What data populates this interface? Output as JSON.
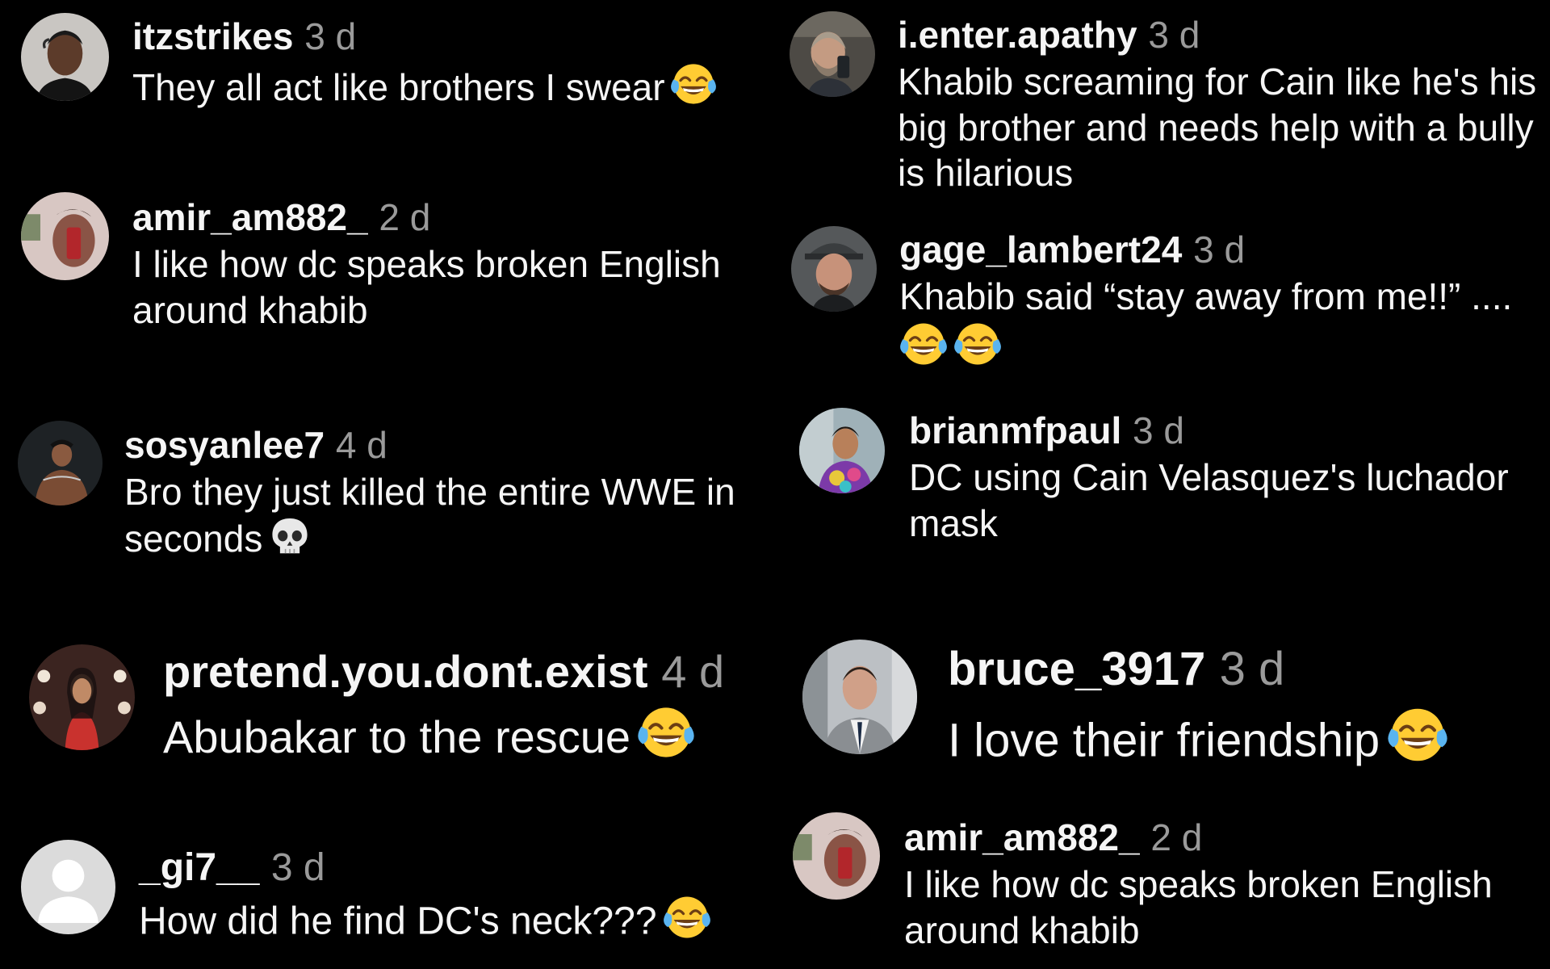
{
  "comments": [
    {
      "username": "itzstrikes",
      "time": "3 d",
      "text": "They all act like brothers I swear",
      "emoji": [
        "face-with-tears-of-joy"
      ]
    },
    {
      "username": "amir_am882_",
      "time": "2 d",
      "text": "I like how dc speaks broken English around khabib",
      "emoji": []
    },
    {
      "username": "sosyanlee7",
      "time": "4 d",
      "text": "Bro they just killed the entire WWE in seconds",
      "emoji": [
        "skull"
      ]
    },
    {
      "username": "pretend.you.dont.exist",
      "time": "4 d",
      "text": "Abubakar to the rescue",
      "emoji": [
        "face-with-tears-of-joy"
      ]
    },
    {
      "username": "_gi7__",
      "time": "3 d",
      "text": "How did he find DC's neck???",
      "emoji": [
        "face-with-tears-of-joy"
      ]
    },
    {
      "username": "i.enter.apathy",
      "time": "3 d",
      "text": "Khabib screaming for Cain like he's his big brother and needs help with a bully is hilarious",
      "emoji": []
    },
    {
      "username": "gage_lambert24",
      "time": "3 d",
      "text": "Khabib said “stay away from me!!” ....",
      "emoji": [
        "face-with-tears-of-joy",
        "face-with-tears-of-joy"
      ]
    },
    {
      "username": "brianmfpaul",
      "time": "3 d",
      "text": "DC using Cain Velasquez's luchador mask",
      "emoji": []
    },
    {
      "username": "bruce_3917",
      "time": "3 d",
      "text": "I love their friendship",
      "emoji": [
        "face-with-tears-of-joy"
      ]
    },
    {
      "username": "amir_am882_",
      "time": "2 d",
      "text": "I like how dc speaks broken English around khabib",
      "emoji": []
    }
  ]
}
